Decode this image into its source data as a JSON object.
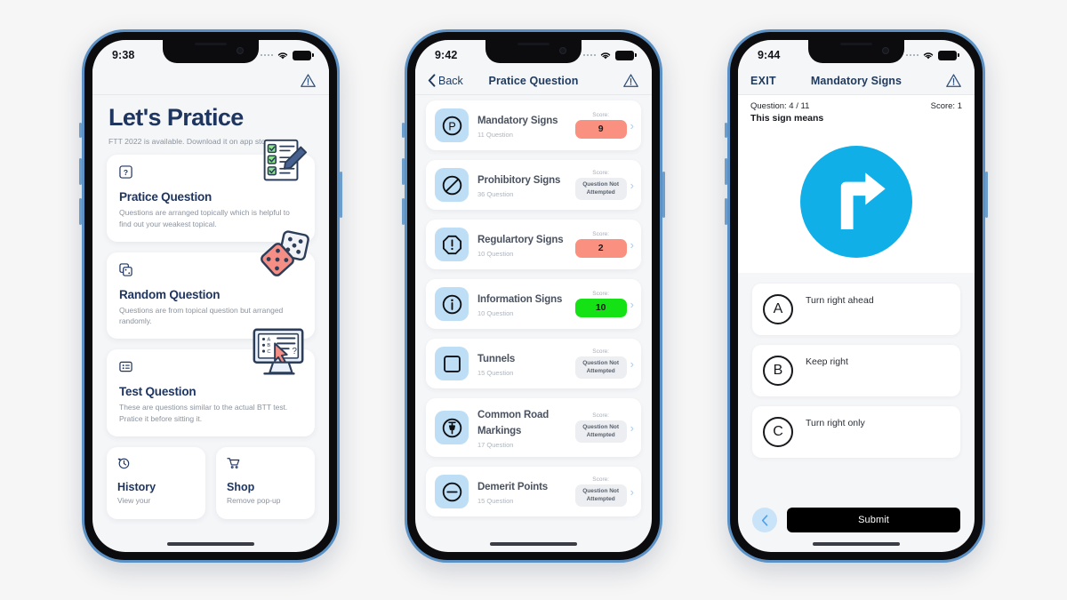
{
  "phones": [
    {
      "id": "phone-practice-home",
      "status_bar": {
        "time": "9:38",
        "wifi_icon": "wifi-icon",
        "battery_icon": "battery-icon",
        "signal_icon": "signal-dots-icon"
      },
      "nav": {
        "right_icon": "warning-triangle-icon"
      },
      "header": {
        "title": "Let's Pratice",
        "subtitle": "FTT 2022 is available. Download it on app store"
      },
      "cards": [
        {
          "icon": "question-box-icon",
          "title": "Pratice Question",
          "desc": "Questions are arranged topically which is helpful to find out your weakest topical.",
          "art": "checklist-clipboard-art"
        },
        {
          "icon": "copy-dice-icon",
          "title": "Random Question",
          "desc": "Questions are from topical question but arranged randomly.",
          "art": "dice-art"
        },
        {
          "icon": "list-card-icon",
          "title": "Test Question",
          "desc": "These are questions similar to the actual BTT test. Pratice it before sitting it.",
          "art": "monitor-cursor-art"
        }
      ],
      "mini_cards": [
        {
          "icon": "history-clock-icon",
          "title": "History",
          "desc": "View your"
        },
        {
          "icon": "shopping-cart-icon",
          "title": "Shop",
          "desc": "Remove pop-up"
        }
      ]
    },
    {
      "id": "phone-topic-list",
      "status_bar": {
        "time": "9:42",
        "wifi_icon": "wifi-icon",
        "battery_icon": "battery-icon",
        "signal_icon": "signal-dots-icon"
      },
      "nav": {
        "back_label": "Back",
        "back_icon": "chevron-left-icon",
        "title": "Pratice Question",
        "right_icon": "warning-triangle-icon"
      },
      "score_label": "Score:",
      "items": [
        {
          "icon": "parking-p-icon",
          "name": "Mandatory Signs",
          "count": "11 Question",
          "score": "9",
          "score_state": "red",
          "chevron": "chevron-right-icon"
        },
        {
          "icon": "no-entry-icon",
          "name": "Prohibitory Signs",
          "count": "36 Question",
          "score": "Question Not Attempted",
          "score_state": "none",
          "chevron": "chevron-right-icon"
        },
        {
          "icon": "octagon-alert-icon",
          "name": "Regulartory Signs",
          "count": "10 Question",
          "score": "2",
          "score_state": "red",
          "chevron": "chevron-right-icon"
        },
        {
          "icon": "info-circle-icon",
          "name": "Information Signs",
          "count": "10 Question",
          "score": "10",
          "score_state": "green",
          "chevron": "chevron-right-icon"
        },
        {
          "icon": "square-icon",
          "name": "Tunnels",
          "count": "15 Question",
          "score": "Question Not Attempted",
          "score_state": "none",
          "chevron": "chevron-right-icon"
        },
        {
          "icon": "pin-circle-icon",
          "name": "Common Road Markings",
          "count": "17 Question",
          "score": "Question Not Attempted",
          "score_state": "none",
          "chevron": "chevron-right-icon"
        },
        {
          "icon": "minus-circle-icon",
          "name": "Demerit Points",
          "count": "15 Question",
          "score": "Question Not Attempted",
          "score_state": "none",
          "chevron": "chevron-right-icon"
        }
      ]
    },
    {
      "id": "phone-question",
      "status_bar": {
        "time": "9:44",
        "wifi_icon": "wifi-icon",
        "battery_icon": "battery-icon",
        "signal_icon": "signal-dots-icon"
      },
      "nav": {
        "exit_label": "EXIT",
        "title": "Mandatory Signs",
        "right_icon": "warning-triangle-icon"
      },
      "question_counter": "Question: 4 / 11",
      "score_text": "Score: 1",
      "prompt": "This sign means",
      "sign": {
        "icon": "turn-right-ahead-sign",
        "color": "#11afe8"
      },
      "answers": [
        {
          "letter": "A",
          "text": "Turn right ahead"
        },
        {
          "letter": "B",
          "text": "Keep right"
        },
        {
          "letter": "C",
          "text": "Turn right only"
        }
      ],
      "prev_icon": "chevron-left-icon",
      "submit_label": "Submit"
    }
  ],
  "colors": {
    "accent_blue": "#11afe8",
    "icon_tile_blue": "#bddef5",
    "badge_red": "#f99080",
    "badge_green": "#14e214",
    "title_navy": "#1e3560",
    "page_bg": "#f6f6f6",
    "phone_edge": "#5b91c4"
  }
}
